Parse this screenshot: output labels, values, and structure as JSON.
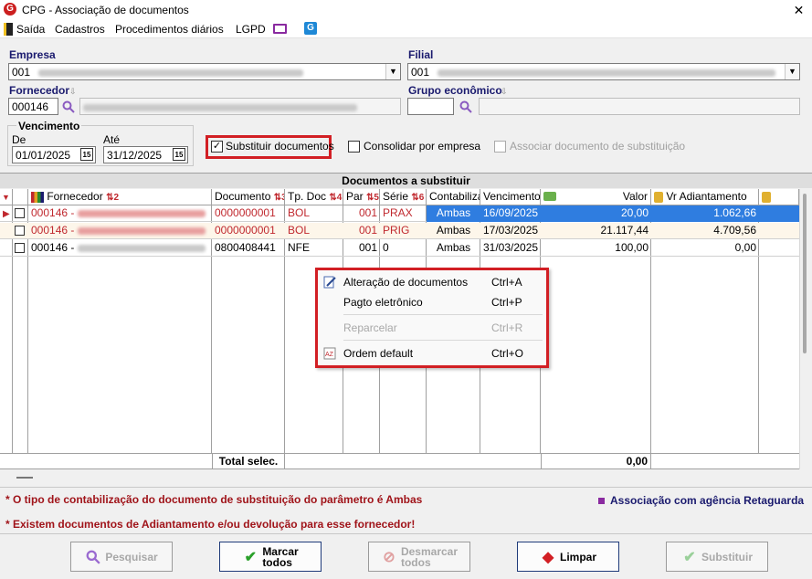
{
  "window": {
    "title": "CPG - Associação de documentos",
    "close": "✕"
  },
  "menu": [
    "Saída",
    "Cadastros",
    "Procedimentos diários",
    "LGPD"
  ],
  "form": {
    "empresa_label": "Empresa",
    "empresa_value": "001",
    "filial_label": "Filial",
    "filial_value": "001",
    "fornecedor_label": "Fornecedor",
    "fornecedor_value": "000146",
    "grupo_label": "Grupo econômico",
    "vencimento_label": "Vencimento",
    "de_label": "De",
    "de_value": "01/01/2025",
    "ate_label": "Até",
    "ate_value": "31/12/2025",
    "substituir_label": "Substituir documentos",
    "consolidar_label": "Consolidar por empresa",
    "associar_label": "Associar documento de substituição"
  },
  "grid": {
    "title": "Documentos a substituir",
    "headers": {
      "fornecedor": "Fornecedor",
      "fornecedor_sort": "2",
      "documento": "Documento",
      "documento_sort": "3",
      "tpdoc": "Tp. Doc",
      "tpdoc_sort": "4",
      "par": "Par",
      "par_sort": "5",
      "serie": "Série",
      "serie_sort": "6",
      "contabiliza": "Contabiliza",
      "vencimento": "Vencimento",
      "valor": "Valor",
      "vradiant": "Vr Adiantamento"
    },
    "rows": [
      {
        "fornecedor": "000146 -",
        "documento": "0000000001",
        "tpdoc": "BOL",
        "par": "001",
        "serie": "PRAX",
        "contabiliza": "Ambas",
        "vencimento": "16/09/2025",
        "valor": "20,00",
        "vradiant": "1.062,66"
      },
      {
        "fornecedor": "000146 -",
        "documento": "0000000001",
        "tpdoc": "BOL",
        "par": "001",
        "serie": "PRIG",
        "contabiliza": "Ambas",
        "vencimento": "17/03/2025",
        "valor": "21.117,44",
        "vradiant": "4.709,56"
      },
      {
        "fornecedor": "000146 -",
        "documento": "0800408441",
        "tpdoc": "NFE",
        "par": "001",
        "serie": "0",
        "contabiliza": "Ambas",
        "vencimento": "31/03/2025",
        "valor": "100,00",
        "vradiant": "0,00"
      }
    ],
    "total_label": "Total selec.",
    "total_value": "0,00"
  },
  "context_menu": {
    "items": [
      {
        "label": "Alteração de documentos",
        "shortcut": "Ctrl+A"
      },
      {
        "label": "Pagto eletrônico",
        "shortcut": "Ctrl+P"
      },
      {
        "label": "Reparcelar",
        "shortcut": "Ctrl+R"
      },
      {
        "label": "Ordem default",
        "shortcut": "Ctrl+O"
      }
    ]
  },
  "notes": {
    "note1": "* O tipo de contabilização do documento de substituição do parâmetro é Ambas",
    "note2": "* Existem documentos de Adiantamento e/ou devolução para esse fornecedor!",
    "assoc": "Associação com agência Retaguarda"
  },
  "buttons": {
    "pesquisar": "Pesquisar",
    "marcar_1": "Marcar",
    "marcar_2": "todos",
    "desmarcar_1": "Desmarcar",
    "desmarcar_2": "todos",
    "limpar": "Limpar",
    "substituir": "Substituir"
  },
  "colors": {
    "accent_red": "#d21f24",
    "selection_blue": "#2f7de0",
    "label_navy": "#1a1a6e"
  }
}
